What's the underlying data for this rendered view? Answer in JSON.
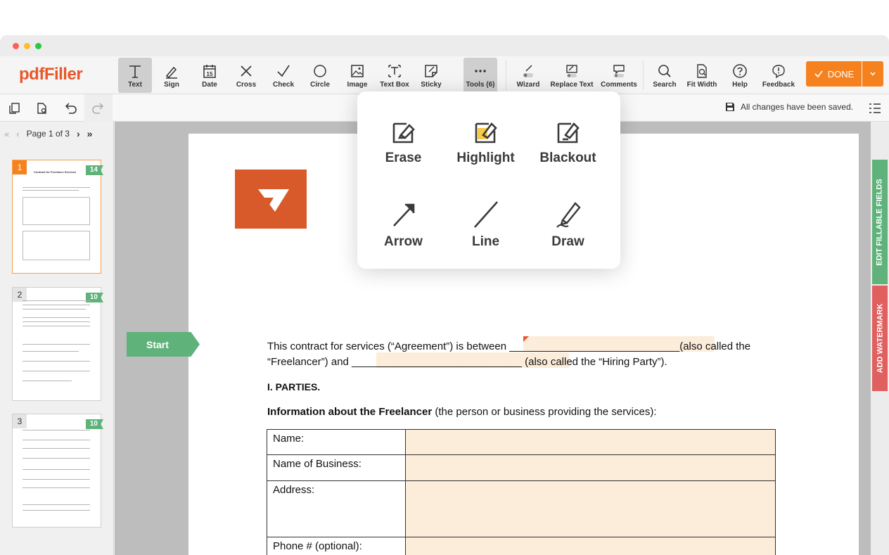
{
  "app": {
    "logo": "pdfFiller",
    "brand_color": "#e7582b",
    "accent_color": "#f5821f"
  },
  "toolbar": {
    "tools": [
      {
        "label": "Text",
        "icon": "text-icon",
        "active": true
      },
      {
        "label": "Sign",
        "icon": "sign-icon"
      },
      {
        "label": "Date",
        "icon": "calendar-icon"
      },
      {
        "label": "Cross",
        "icon": "cross-icon"
      },
      {
        "label": "Check",
        "icon": "check-icon"
      },
      {
        "label": "Circle",
        "icon": "circle-icon"
      },
      {
        "label": "Image",
        "icon": "image-icon"
      },
      {
        "label": "Text Box",
        "icon": "textbox-icon"
      },
      {
        "label": "Sticky",
        "icon": "sticky-icon"
      },
      {
        "label": "Tools (6)",
        "icon": "more-icon",
        "active": true
      },
      {
        "label": "Wizard",
        "icon": "wizard-icon"
      },
      {
        "label": "Replace Text",
        "icon": "replace-text-icon"
      },
      {
        "label": "Comments",
        "icon": "comments-icon"
      },
      {
        "label": "Search",
        "icon": "search-icon"
      },
      {
        "label": "Fit Width",
        "icon": "fit-width-icon"
      },
      {
        "label": "Help",
        "icon": "help-icon"
      },
      {
        "label": "Feedback",
        "icon": "feedback-icon"
      }
    ],
    "done_label": "DONE"
  },
  "subbar": {
    "status": "All changes have been saved."
  },
  "sidebar": {
    "page_label": "Page 1 of 3",
    "pages": [
      {
        "num": "1",
        "count": "14",
        "selected": true
      },
      {
        "num": "2",
        "count": "10",
        "selected": false
      },
      {
        "num": "3",
        "count": "10",
        "selected": false
      }
    ],
    "thumb1_title": "Contract for Freelance Services"
  },
  "popup": {
    "items": [
      {
        "label": "Erase",
        "icon": "erase-icon"
      },
      {
        "label": "Highlight",
        "icon": "highlight-icon"
      },
      {
        "label": "Blackout",
        "icon": "blackout-icon"
      },
      {
        "label": "Arrow",
        "icon": "arrow-icon"
      },
      {
        "label": "Line",
        "icon": "line-icon"
      },
      {
        "label": "Draw",
        "icon": "draw-icon"
      }
    ]
  },
  "document": {
    "start_label": "Start",
    "line1a": "This contract for services (“Agreement”) is between ",
    "line1b": "_____________________________(also called the",
    "line2a": "“Freelancer”) and ",
    "line2b": "_____________________________ (also called the “Hiring Party”).",
    "section": "I.   PARTIES.",
    "info_bold": "Information about the Freelancer",
    "info_rest": " (the person or business providing the services):",
    "table_rows": [
      "Name:",
      "Name of Business:",
      "Address:",
      "Phone # (optional):"
    ]
  },
  "rightrail": {
    "edit_fields": "EDIT FILLABLE FIELDS",
    "watermark": "ADD WATERMARK",
    "edit_color": "#5fb37a",
    "watermark_color": "#e06060"
  }
}
